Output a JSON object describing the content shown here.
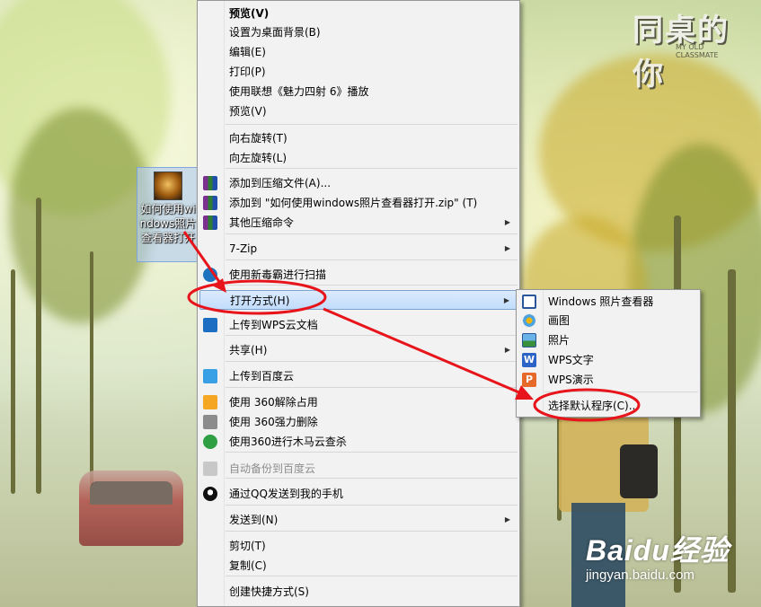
{
  "wallpaper": {
    "title_logo": "同桌的你",
    "title_sub": "MY OLD\nCLASSMATE",
    "watermark": {
      "logo": "Baidu经验",
      "url": "jingyan.baidu.com"
    }
  },
  "desktop": {
    "icon_label": "如何使用windows照片查看器打开"
  },
  "context_menu": {
    "items": [
      {
        "label": "预览(V)",
        "bold": true
      },
      {
        "label": "设置为桌面背景(B)"
      },
      {
        "label": "编辑(E)"
      },
      {
        "label": "打印(P)"
      },
      {
        "label": "使用联想《魅力四射 6》播放"
      },
      {
        "label": "预览(V)"
      },
      {
        "label": "向右旋转(T)"
      },
      {
        "label": "向左旋转(L)"
      },
      {
        "label": "添加到压缩文件(A)...",
        "icon": "winrar-icon"
      },
      {
        "label": "添加到 \"如何使用windows照片查看器打开.zip\" (T)",
        "icon": "winrar-icon"
      },
      {
        "label": "其他压缩命令",
        "icon": "winrar-icon",
        "submenu": true
      },
      {
        "label": "7-Zip",
        "submenu": true
      },
      {
        "label": "使用新毒霸进行扫描",
        "icon": "duba-antivirus-icon"
      },
      {
        "label": "打开方式(H)",
        "submenu": true,
        "highlighted": true
      },
      {
        "label": "上传到WPS云文档",
        "icon": "wps-cloud-icon"
      },
      {
        "label": "共享(H)",
        "submenu": true
      },
      {
        "label": "上传到百度云",
        "icon": "baidu-cloud-icon"
      },
      {
        "label": "使用 360解除占用",
        "icon": "360-unlock-icon"
      },
      {
        "label": "使用 360强力删除",
        "icon": "360-shred-icon"
      },
      {
        "label": "使用360进行木马云查杀",
        "icon": "360-trojan-scan-icon"
      },
      {
        "label": "自动备份到百度云",
        "icon": "baidu-backup-icon",
        "disabled": true
      },
      {
        "label": "通过QQ发送到我的手机",
        "icon": "qq-penguin-icon"
      },
      {
        "label": "发送到(N)",
        "submenu": true
      },
      {
        "label": "剪切(T)"
      },
      {
        "label": "复制(C)"
      },
      {
        "label": "创建快捷方式(S)"
      }
    ]
  },
  "open_with_submenu": {
    "items": [
      {
        "label": "Windows 照片查看器",
        "icon": "photo-viewer-icon"
      },
      {
        "label": "画图",
        "icon": "paint-icon"
      },
      {
        "label": "照片",
        "icon": "photos-app-icon"
      },
      {
        "label": "WPS文字",
        "icon": "wps-writer-icon",
        "glyph": "W"
      },
      {
        "label": "WPS演示",
        "icon": "wps-presentation-icon",
        "glyph": "P"
      },
      {
        "label": "选择默认程序(C)..."
      }
    ]
  },
  "annotation_color": "#e8141b"
}
